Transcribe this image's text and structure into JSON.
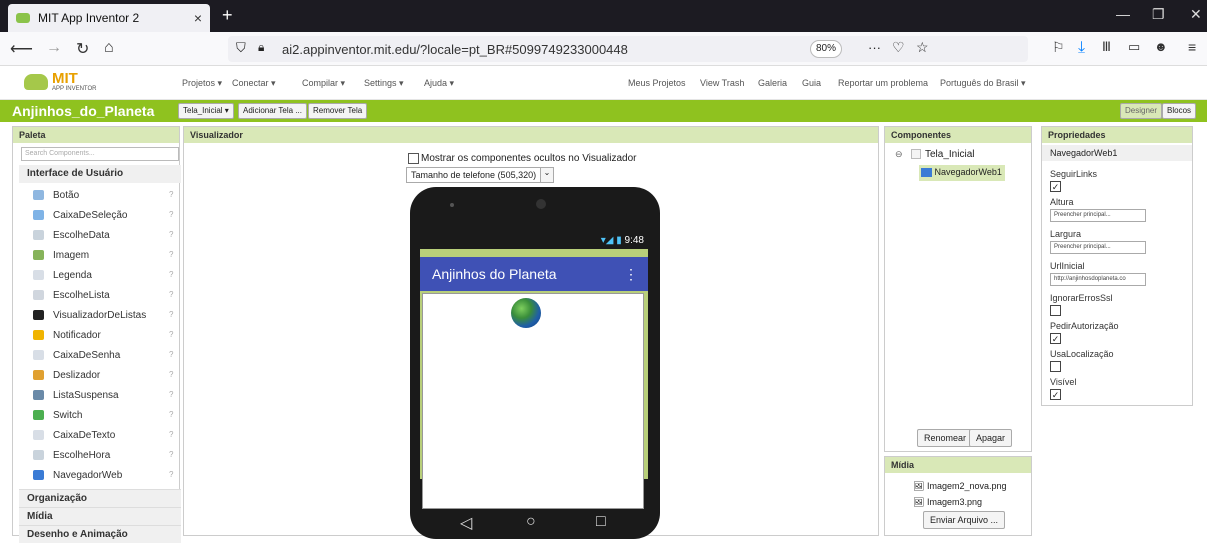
{
  "browser": {
    "tab_title": "MIT App Inventor 2",
    "url": "ai2.appinventor.mit.edu/?locale=pt_BR#5099749233000448",
    "zoom": "80%"
  },
  "header": {
    "logo_main": "MIT",
    "logo_sub": "APP INVENTOR",
    "menus": [
      "Projetos ▾",
      "Conectar ▾",
      "Compilar ▾",
      "Settings ▾",
      "Ajuda ▾"
    ],
    "right_links": [
      "Meus Projetos",
      "View Trash",
      "Galeria",
      "Guia",
      "Reportar um problema",
      "Português do Brasil ▾"
    ]
  },
  "projectbar": {
    "name": "Anjinhos_do_Planeta",
    "screen_btn": "Tela_Inicial ▾",
    "add_screen": "Adicionar Tela ...",
    "remove_screen": "Remover Tela",
    "designer": "Designer",
    "blocks": "Blocos"
  },
  "palette": {
    "title": "Paleta",
    "search_placeholder": "Search Components...",
    "category": "Interface de Usuário",
    "items": [
      "Botão",
      "CaixaDeSeleção",
      "EscolheData",
      "Imagem",
      "Legenda",
      "EscolheLista",
      "VisualizadorDeListas",
      "Notificador",
      "CaixaDeSenha",
      "Deslizador",
      "ListaSuspensa",
      "Switch",
      "CaixaDeTexto",
      "EscolheHora",
      "NavegadorWeb"
    ],
    "other_categories": [
      "Organização",
      "Mídia",
      "Desenho e Animação"
    ]
  },
  "viewer": {
    "title": "Visualizador",
    "hidden_label": "Mostrar os componentes ocultos no Visualizador",
    "size_select": "Tamanho de telefone (505,320)",
    "phone_time": "9:48",
    "app_title": "Anjinhos do Planeta"
  },
  "components": {
    "title": "Componentes",
    "root": "Tela_Inicial",
    "child": "NavegadorWeb1",
    "rename": "Renomear",
    "delete": "Apagar"
  },
  "media": {
    "title": "Mídia",
    "files": [
      "Imagem2_nova.png",
      "Imagem3.png"
    ],
    "upload": "Enviar Arquivo ..."
  },
  "properties": {
    "title": "Propriedades",
    "component": "NavegadorWeb1",
    "seguir": "SeguirLinks",
    "altura": "Altura",
    "altura_val": "Preencher principal...",
    "largura": "Largura",
    "largura_val": "Preencher principal...",
    "url": "UrlInicial",
    "url_val": "http://anjinhosdoplaneta.co",
    "ignorar": "IgnorarErrosSsl",
    "pedir": "PedirAutorização",
    "usaloc": "UsaLocalização",
    "visivel": "Visível"
  }
}
